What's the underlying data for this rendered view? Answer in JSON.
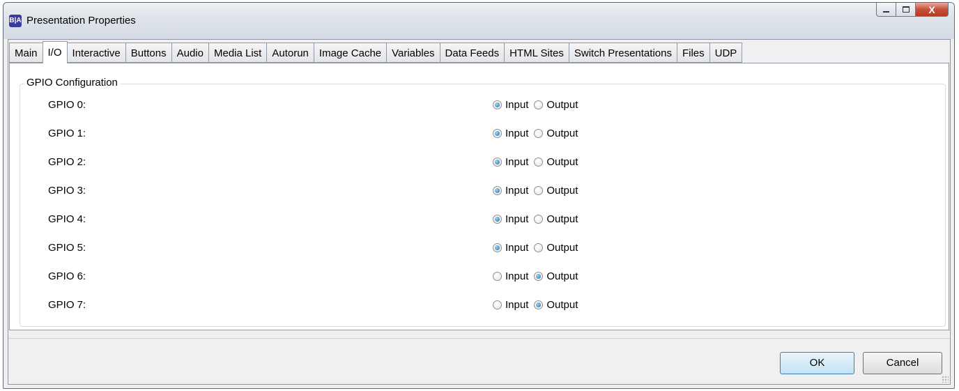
{
  "window": {
    "title": "Presentation Properties",
    "app_icon_text": "B|A",
    "controls": {
      "minimize": "minimize",
      "maximize": "maximize",
      "close": "X"
    }
  },
  "tabs": [
    {
      "label": "Main",
      "active": false
    },
    {
      "label": "I/O",
      "active": true
    },
    {
      "label": "Interactive",
      "active": false
    },
    {
      "label": "Buttons",
      "active": false
    },
    {
      "label": "Audio",
      "active": false
    },
    {
      "label": "Media List",
      "active": false
    },
    {
      "label": "Autorun",
      "active": false
    },
    {
      "label": "Image Cache",
      "active": false
    },
    {
      "label": "Variables",
      "active": false
    },
    {
      "label": "Data Feeds",
      "active": false
    },
    {
      "label": "HTML Sites",
      "active": false
    },
    {
      "label": "Switch Presentations",
      "active": false
    },
    {
      "label": "Files",
      "active": false
    },
    {
      "label": "UDP",
      "active": false
    }
  ],
  "gpio": {
    "group_label": "GPIO Configuration",
    "input_label": "Input",
    "output_label": "Output",
    "rows": [
      {
        "label": "GPIO 0:",
        "mode": "Input"
      },
      {
        "label": "GPIO 1:",
        "mode": "Input"
      },
      {
        "label": "GPIO 2:",
        "mode": "Input"
      },
      {
        "label": "GPIO 3:",
        "mode": "Input"
      },
      {
        "label": "GPIO 4:",
        "mode": "Input"
      },
      {
        "label": "GPIO 5:",
        "mode": "Input"
      },
      {
        "label": "GPIO 6:",
        "mode": "Output"
      },
      {
        "label": "GPIO 7:",
        "mode": "Output"
      }
    ]
  },
  "footer": {
    "ok_label": "OK",
    "cancel_label": "Cancel"
  },
  "colors": {
    "selected_radio": "#1f6ea8",
    "close_button": "#c7503a"
  }
}
